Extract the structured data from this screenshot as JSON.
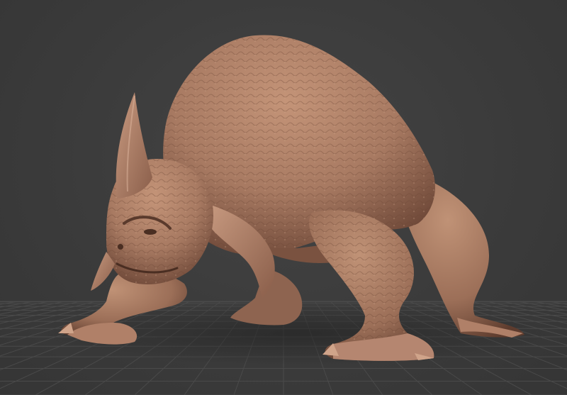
{
  "viewport": {
    "background_color": "#3a3a3a",
    "grid_color": "#4a4a4a",
    "grid_visible": true
  },
  "model": {
    "name": "rhino-beast-sculpt",
    "material_color": "#a87a62",
    "shadow_color": "#5a3a2c",
    "highlight_color": "#c89a80"
  }
}
